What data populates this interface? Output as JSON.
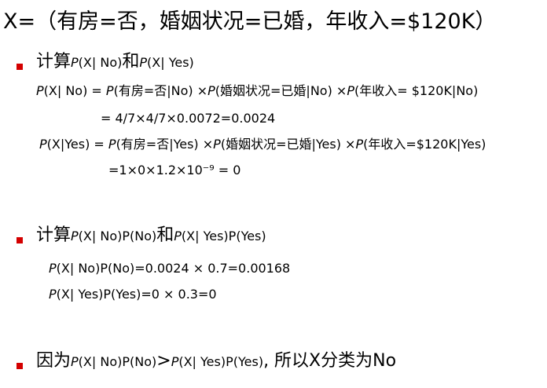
{
  "title": "X=（有房=否，婚姻状况=已婚，年收入=$120K）",
  "bullet_color": "#d40000",
  "section1": {
    "lead": "计算",
    "p1": "P",
    "t1": "(X| No)",
    "and": "和",
    "p2": "P",
    "t2": "(X| Yes)",
    "formula_no": {
      "p_a": "P",
      "a": "(X| No) = ",
      "p_b": "P",
      "b": "(有房=否|No) ×",
      "p_c": "P",
      "c": "(婚姻状况=已婚|No) ×",
      "p_d": "P",
      "d": "(年收入= $120K|No)"
    },
    "result_no": "= 4/7×4/7×0.0072=0.0024",
    "formula_yes": {
      "p_a": "P",
      "a": "(X|Yes) = ",
      "p_b": "P",
      "b": "(有房=否|Yes) ×",
      "p_c": "P",
      "c": "(婚姻状况=已婚|Yes) ×",
      "p_d": "P",
      "d": "(年收入=$120K|Yes)"
    },
    "result_yes": "=1×0×1.2×10⁻⁹ = 0"
  },
  "section2": {
    "lead": "计算",
    "p1": "P",
    "t1": "(X| No)P(No)",
    "and": "和",
    "p2": "P",
    "t2": "(X| Yes)P(Yes)",
    "calc_no_p": "P",
    "calc_no": "(X| No)P(No)=0.0024 × 0.7=0.00168",
    "calc_yes_p": "P",
    "calc_yes": "(X| Yes)P(Yes)=0 × 0.3=0"
  },
  "section3": {
    "lead": "因为",
    "p1": "P",
    "t1": "(X| No)P(No)",
    "gt": ">",
    "p2": "P",
    "t2": "(X| Yes)P(Yes)",
    "conclusion": ", 所以X分类为No"
  }
}
